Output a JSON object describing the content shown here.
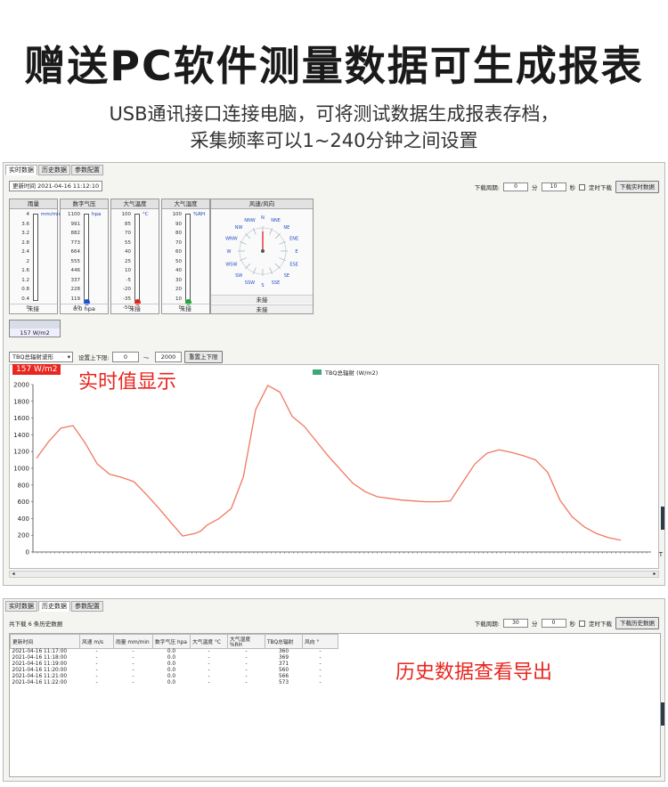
{
  "hero": {
    "title": "赠送PC软件测量数据可生成报表",
    "sub1": "USB通讯接口连接电脑，可将测试数据生成报表存档，",
    "sub2": "采集频率可以1~240分钟之间设置"
  },
  "window1": {
    "tabs": [
      "实时数据",
      "历史数据",
      "参数配置"
    ],
    "update_time": "更新时间 2021-04-16 11:12:10",
    "download_period_label": "下载周期:",
    "min_value": "0",
    "min_unit": "分",
    "sec_value": "10",
    "sec_unit": "秒",
    "timed_download_label": "定时下载",
    "download_button": "下载实时数据",
    "gauges": [
      {
        "title": "雨量",
        "unit": "mm/min",
        "ticks": [
          "4",
          "3.6",
          "3.2",
          "2.8",
          "2.4",
          "2",
          "1.6",
          "1.2",
          "0.8",
          "0.4",
          "0"
        ],
        "value": "未接",
        "bulb_color": ""
      },
      {
        "title": "数字气压",
        "unit": "hpa",
        "ticks": [
          "1100",
          "991",
          "882",
          "773",
          "664",
          "555",
          "446",
          "337",
          "228",
          "119",
          "10"
        ],
        "value": "0.0 hpa",
        "bulb_color": "#1f4fd6"
      },
      {
        "title": "大气温度",
        "unit": "°C",
        "ticks": [
          "100",
          "85",
          "70",
          "55",
          "40",
          "25",
          "10",
          "-5",
          "-20",
          "-35",
          "-50"
        ],
        "value": "未接",
        "bulb_color": "#e0261e"
      },
      {
        "title": "大气湿度",
        "unit": "%RH",
        "ticks": [
          "100",
          "90",
          "80",
          "70",
          "60",
          "50",
          "40",
          "30",
          "20",
          "10",
          "0"
        ],
        "value": "未接",
        "bulb_color": "#1fa838"
      }
    ],
    "wind": {
      "title": "风速/风向",
      "directions": [
        "N",
        "NNE",
        "NE",
        "ENE",
        "E",
        "ESE",
        "SE",
        "SSE",
        "S",
        "SSW",
        "SW",
        "WSW",
        "W",
        "WNW",
        "NW",
        "NNW"
      ],
      "value1": "未接",
      "value2": "未接"
    },
    "radiation_value": "157 W/m2",
    "curve_select": "TBQ总辐射波形",
    "limit_label": "设置上下限:",
    "lower_limit": "0",
    "tilde": "～",
    "upper_limit": "2000",
    "reset_limit_button": "重置上下限",
    "realtime_badge": "157 W/m2",
    "annotation": "实时值显示",
    "side_marker": "T"
  },
  "chart_data": {
    "type": "line",
    "title": "",
    "series": [
      {
        "name": "TBQ总辐射 (W/m2)",
        "color": "#f07860",
        "x": [
          0,
          4,
          8,
          12,
          16,
          20,
          24,
          28,
          32,
          36,
          40,
          44,
          48,
          52,
          54,
          56,
          60,
          64,
          68,
          72,
          76,
          80,
          84,
          88,
          92,
          96,
          100,
          104,
          108,
          112,
          116,
          120,
          124,
          128,
          132,
          136,
          140,
          144,
          148,
          152,
          156,
          160,
          164,
          168,
          172,
          176,
          180,
          184,
          188,
          192
        ],
        "values": [
          1120,
          1320,
          1480,
          1510,
          1300,
          1050,
          930,
          890,
          840,
          690,
          530,
          360,
          190,
          220,
          250,
          320,
          400,
          520,
          900,
          1700,
          1990,
          1910,
          1620,
          1500,
          1320,
          1140,
          980,
          820,
          720,
          660,
          640,
          620,
          610,
          600,
          600,
          610,
          830,
          1050,
          1180,
          1220,
          1190,
          1150,
          1100,
          950,
          620,
          420,
          300,
          220,
          170,
          140
        ]
      }
    ],
    "ylim": [
      0,
      2000
    ],
    "yticks": [
      "0",
      "200",
      "400",
      "600",
      "800",
      "1000",
      "1200",
      "1400",
      "1600",
      "1800",
      "2000"
    ],
    "xlabel": "",
    "ylabel": "",
    "grid": false,
    "legend": "top-center"
  },
  "window2": {
    "tabs": [
      "实时数据",
      "历史数据",
      "参数配置"
    ],
    "record_count": "共下载 6 条历史数据",
    "download_period_label": "下载周期:",
    "min_value": "30",
    "min_unit": "分",
    "sec_value": "0",
    "sec_unit": "秒",
    "timed_download_label": "定时下载",
    "download_button": "下载历史数据",
    "columns": [
      "更新时间",
      "风速 m/s",
      "雨量 mm/min",
      "数字气压 hpa",
      "大气温度 °C",
      "大气湿度 %RH",
      "TBQ总辐射",
      "风向 °"
    ],
    "rows": [
      [
        "2021-04-16 11:17:00",
        "-",
        "-",
        "0.0",
        "-",
        "-",
        "360",
        "-"
      ],
      [
        "2021-04-16 11:18:00",
        "-",
        "-",
        "0.0",
        "-",
        "-",
        "369",
        "-"
      ],
      [
        "2021-04-16 11:19:00",
        "-",
        "-",
        "0.0",
        "-",
        "-",
        "371",
        "-"
      ],
      [
        "2021-04-16 11:20:00",
        "-",
        "-",
        "0.0",
        "-",
        "-",
        "560",
        "-"
      ],
      [
        "2021-04-16 11:21:00",
        "-",
        "-",
        "0.0",
        "-",
        "-",
        "566",
        "-"
      ],
      [
        "2021-04-16 11:22:00",
        "-",
        "-",
        "0.0",
        "-",
        "-",
        "573",
        "-"
      ]
    ],
    "annotation": "历史数据查看导出"
  }
}
